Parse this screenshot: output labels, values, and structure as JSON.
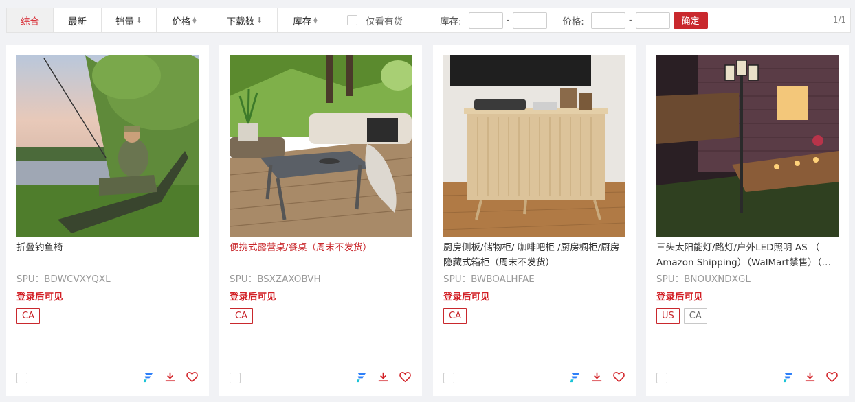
{
  "toolbar": {
    "tabs": {
      "comprehensive": "综合",
      "latest": "最新",
      "sales": "销量",
      "price": "价格",
      "downloads": "下载数",
      "stock": "库存"
    },
    "instock_only": "仅看有货",
    "stock_range_label": "库存:",
    "price_range_label": "价格:",
    "confirm": "确定",
    "page_indicator": "1/1",
    "stock_min": "",
    "stock_max": "",
    "price_min": "",
    "price_max": ""
  },
  "products": [
    {
      "title": "折叠钓鱼椅",
      "spu": "SPU：BDWCVXYQXL",
      "login_note": "登录后可见",
      "tags": [
        "CA"
      ]
    },
    {
      "title": "便携式露营桌/餐桌（周末不发货）",
      "spu": "SPU：BSXZAXOBVH",
      "login_note": "登录后可见",
      "tags": [
        "CA"
      ]
    },
    {
      "title": "厨房侧板/储物柜/ 咖啡吧柜 /厨房橱柜/厨房隐藏式箱柜（周末不发货）",
      "spu": "SPU：BWBOALHFAE",
      "login_note": "登录后可见",
      "tags": [
        "CA"
      ]
    },
    {
      "title": "三头太阳能灯/路灯/户外LED照明 AS （ Amazon Shipping）（WalMart禁售）（周末不发货）",
      "spu": "SPU：BNOUXNDXGL",
      "login_note": "登录后可见",
      "tags": [
        "US",
        "CA"
      ]
    }
  ],
  "colors": {
    "accent": "#c9282d",
    "brand_icon": "#2d7ff9"
  },
  "icons": [
    "chevron-down-icon",
    "sort-updown-icon",
    "brand-f-icon",
    "download-icon",
    "heart-icon"
  ]
}
